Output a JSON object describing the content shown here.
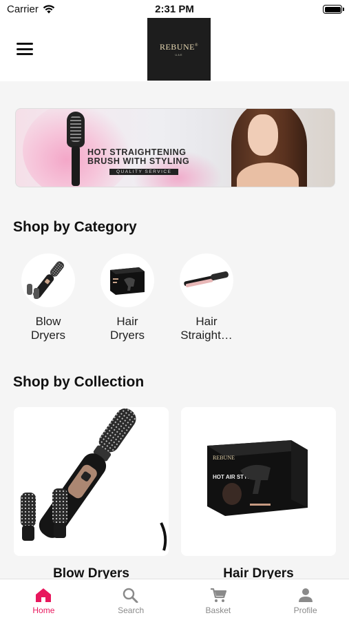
{
  "status_bar": {
    "carrier": "Carrier",
    "time": "2:31 PM"
  },
  "header": {
    "logo_text": "REBUNE",
    "logo_mark": "®",
    "logo_sub": "UAE"
  },
  "banner": {
    "headline_line1": "HOT STRAIGHTENING",
    "headline_line2": "BRUSH WITH STYLING",
    "tagline": "QUALITY SERVICE"
  },
  "categories": {
    "title": "Shop by Category",
    "items": [
      {
        "line1": "Blow",
        "line2": "Dryers",
        "icon": "blow-dryer-brush-icon"
      },
      {
        "line1": "Hair",
        "line2": "Dryers",
        "icon": "hair-dryer-box-icon"
      },
      {
        "line1": "Hair",
        "line2": "Straight…",
        "icon": "hair-straightener-icon"
      }
    ]
  },
  "collection": {
    "title": "Shop by Collection",
    "items": [
      {
        "label": "Blow Dryers"
      },
      {
        "label": "Hair Dryers",
        "box_text": "HOT AIR STYLE"
      }
    ]
  },
  "tabbar": {
    "items": [
      {
        "label": "Home",
        "icon": "home-icon",
        "active": true
      },
      {
        "label": "Search",
        "icon": "search-icon",
        "active": false
      },
      {
        "label": "Basket",
        "icon": "cart-icon",
        "active": false
      },
      {
        "label": "Profile",
        "icon": "person-icon",
        "active": false
      }
    ]
  },
  "colors": {
    "accent": "#e8175d",
    "background": "#f5f5f5",
    "logo_bg": "#1d1d1d"
  }
}
